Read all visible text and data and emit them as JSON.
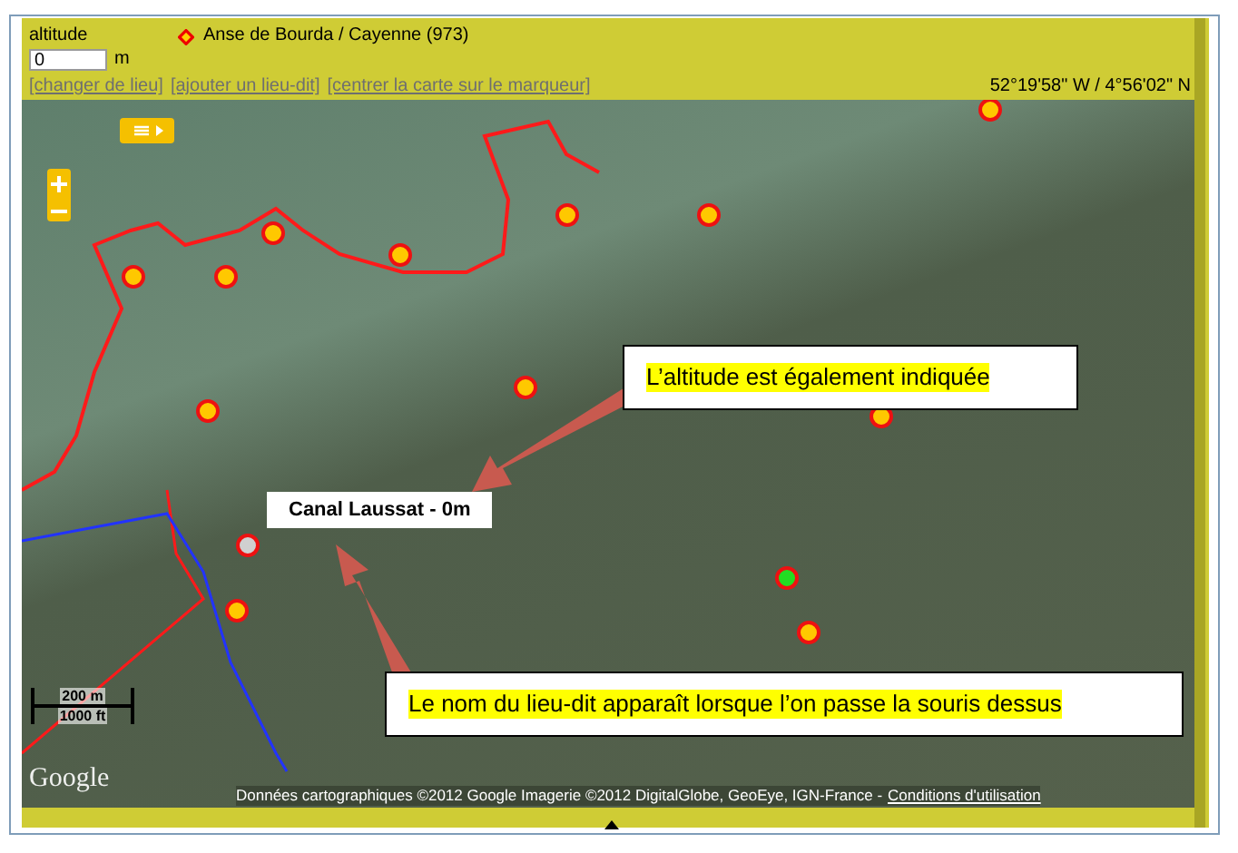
{
  "header": {
    "altitude_label": "altitude",
    "altitude_value": "0",
    "altitude_unit": "m",
    "place": "Anse de Bourda / Cayenne (973)",
    "links": [
      "[changer de lieu]",
      "[ajouter un lieu-dit]",
      "[centrer la carte sur le marqueur]"
    ],
    "coordinates": "52°19'58\" W / 4°56'02\" N"
  },
  "map": {
    "markers": [
      {
        "kind": "place"
      },
      {
        "kind": "place"
      },
      {
        "kind": "place"
      },
      {
        "kind": "place"
      },
      {
        "kind": "place"
      },
      {
        "kind": "place"
      },
      {
        "kind": "place"
      },
      {
        "kind": "place"
      },
      {
        "kind": "place"
      },
      {
        "kind": "place"
      },
      {
        "kind": "hovered"
      },
      {
        "kind": "place"
      },
      {
        "kind": "current"
      },
      {
        "kind": "place"
      }
    ],
    "tooltip": "Canal Laussat - 0m",
    "scale": [
      "200 m",
      "1000 ft"
    ],
    "logo": "Google",
    "attribution": "Données cartographiques ©2012 Google Imagerie ©2012 DigitalGlobe, GeoEye, IGN-France -",
    "terms": "Conditions d'utilisation"
  },
  "callouts": [
    {
      "text": "L’altitude est également indiquée"
    },
    {
      "text": "Le nom du lieu-dit apparaît lorsque l’on passe la souris dessus"
    }
  ]
}
